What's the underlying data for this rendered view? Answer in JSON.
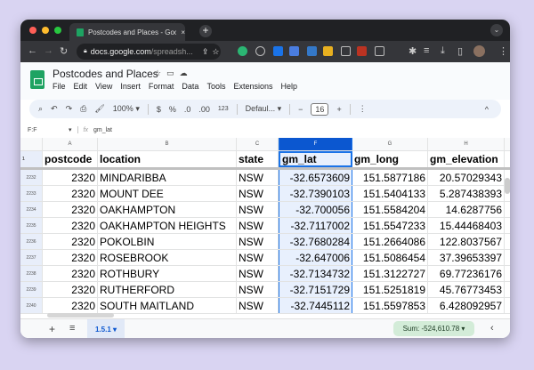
{
  "browser": {
    "tab_title": "Postcodes and Places - Google Sheets",
    "tab_title_visible": "Postcodes and Places - Googl",
    "url_host": "docs.google.com",
    "url_path": "/spreadsh...",
    "new_tab": "+",
    "close": "×"
  },
  "doc": {
    "title": "Postcodes and Places",
    "menus": [
      "File",
      "Edit",
      "View",
      "Insert",
      "Format",
      "Data",
      "Tools",
      "Extensions",
      "Help"
    ]
  },
  "toolbar": {
    "zoom": "100%",
    "currency": "$",
    "percent": "%",
    "dec_less": ".0",
    "dec_more": ".00",
    "number_format": "123",
    "font": "Defaul...",
    "font_size": "16",
    "minus": "−",
    "plus": "+"
  },
  "formula": {
    "name_box": "F:F",
    "fx": "fx",
    "content": "gm_lat"
  },
  "columns": [
    "A",
    "B",
    "C",
    "F",
    "G",
    "H"
  ],
  "header_row": {
    "num": "1",
    "cells": [
      "postcode",
      "location",
      "state",
      "gm_lat",
      "gm_long",
      "gm_elevation"
    ]
  },
  "rows": [
    {
      "num": "2232",
      "cells": [
        "2320",
        "MINDARIBBA",
        "NSW",
        "-32.6573609",
        "151.5877186",
        "20.57029343"
      ]
    },
    {
      "num": "2233",
      "cells": [
        "2320",
        "MOUNT DEE",
        "NSW",
        "-32.7390103",
        "151.5404133",
        "5.287438393"
      ]
    },
    {
      "num": "2234",
      "cells": [
        "2320",
        "OAKHAMPTON",
        "NSW",
        "-32.700056",
        "151.5584204",
        "14.6287756"
      ]
    },
    {
      "num": "2235",
      "cells": [
        "2320",
        "OAKHAMPTON HEIGHTS",
        "NSW",
        "-32.7117002",
        "151.5547233",
        "15.44468403"
      ]
    },
    {
      "num": "2236",
      "cells": [
        "2320",
        "POKOLBIN",
        "NSW",
        "-32.7680284",
        "151.2664086",
        "122.8037567"
      ]
    },
    {
      "num": "2237",
      "cells": [
        "2320",
        "ROSEBROOK",
        "NSW",
        "-32.647006",
        "151.5086454",
        "37.39653397"
      ]
    },
    {
      "num": "2238",
      "cells": [
        "2320",
        "ROTHBURY",
        "NSW",
        "-32.7134732",
        "151.3122727",
        "69.77236176"
      ]
    },
    {
      "num": "2239",
      "cells": [
        "2320",
        "RUTHERFORD",
        "NSW",
        "-32.7151729",
        "151.5251819",
        "45.76773453"
      ]
    },
    {
      "num": "2240",
      "cells": [
        "2320",
        "SOUTH MAITLAND",
        "NSW",
        "-32.7445112",
        "151.5597853",
        "6.428092957"
      ]
    }
  ],
  "bottom": {
    "add": "+",
    "list": "≡",
    "sheet_tab": "1.5.1 ▾",
    "sum": "Sum: -524,610.78 ▾",
    "collapse": "‹"
  },
  "colors": {
    "accent": "#0b57d0",
    "sheets_green": "#1ea362",
    "sum_bg": "#d3ecd8"
  }
}
